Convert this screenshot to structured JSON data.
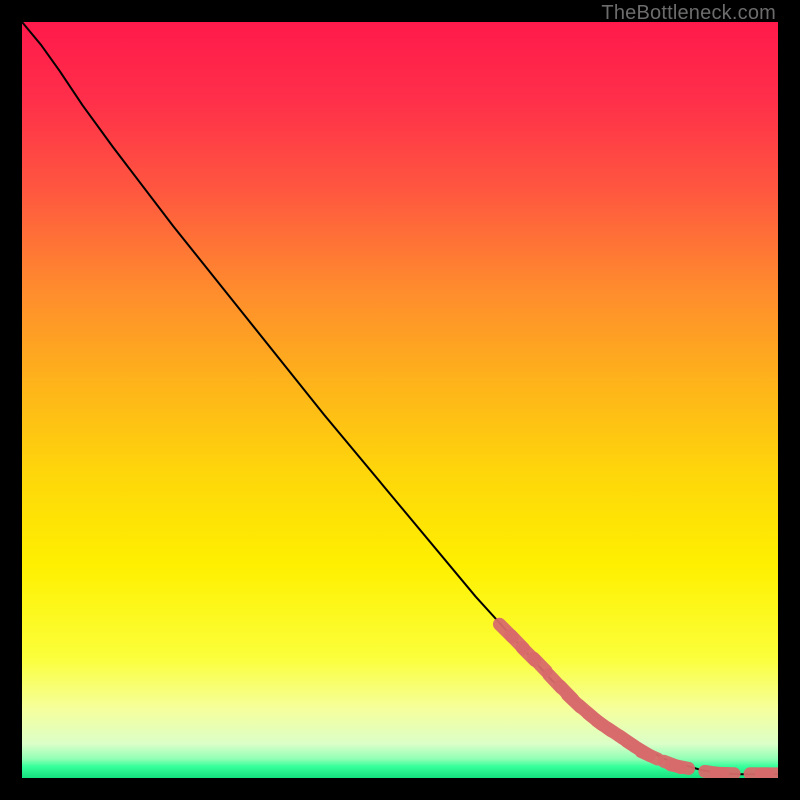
{
  "watermark": "TheBottleneck.com",
  "colors": {
    "background": "#000000",
    "line": "#000000",
    "dot": "#d86b6b",
    "gradient_stops": [
      {
        "offset": 0.0,
        "color": "#ff1a4b"
      },
      {
        "offset": 0.1,
        "color": "#ff2e4a"
      },
      {
        "offset": 0.22,
        "color": "#ff5640"
      },
      {
        "offset": 0.35,
        "color": "#ff8a2e"
      },
      {
        "offset": 0.48,
        "color": "#feb41a"
      },
      {
        "offset": 0.6,
        "color": "#fed70a"
      },
      {
        "offset": 0.72,
        "color": "#fef000"
      },
      {
        "offset": 0.84,
        "color": "#fbff3a"
      },
      {
        "offset": 0.91,
        "color": "#f5ff9e"
      },
      {
        "offset": 0.955,
        "color": "#dbffc8"
      },
      {
        "offset": 0.975,
        "color": "#8fffb5"
      },
      {
        "offset": 0.985,
        "color": "#34ff9a"
      },
      {
        "offset": 1.0,
        "color": "#15e07f"
      }
    ]
  },
  "chart_data": {
    "type": "line",
    "title": "",
    "xlabel": "",
    "ylabel": "",
    "xlim": [
      0,
      100
    ],
    "ylim": [
      0,
      100
    ],
    "legend": false,
    "grid": false,
    "series": [
      {
        "name": "bottleneck-curve",
        "x": [
          0.0,
          2.5,
          5.0,
          8.0,
          12.0,
          20.0,
          30.0,
          40.0,
          50.0,
          60.0,
          70.0,
          78.0,
          85.0,
          90.0,
          93.0,
          95.0,
          97.0,
          100.0
        ],
        "y": [
          100.0,
          97.0,
          93.5,
          89.0,
          83.5,
          73.0,
          60.5,
          48.0,
          36.0,
          24.0,
          13.0,
          6.5,
          2.5,
          1.0,
          0.6,
          0.5,
          0.5,
          0.5
        ]
      }
    ],
    "markers": [
      {
        "x": 64.0,
        "y": 19.5
      },
      {
        "x": 65.5,
        "y": 18.0
      },
      {
        "x": 67.0,
        "y": 16.4
      },
      {
        "x": 68.5,
        "y": 15.0
      },
      {
        "x": 70.5,
        "y": 12.8
      },
      {
        "x": 72.0,
        "y": 11.3
      },
      {
        "x": 73.0,
        "y": 10.2
      },
      {
        "x": 74.5,
        "y": 8.9
      },
      {
        "x": 75.8,
        "y": 7.8
      },
      {
        "x": 77.0,
        "y": 6.9
      },
      {
        "x": 78.5,
        "y": 5.9
      },
      {
        "x": 80.0,
        "y": 4.9
      },
      {
        "x": 81.0,
        "y": 4.2
      },
      {
        "x": 82.0,
        "y": 3.6
      },
      {
        "x": 83.0,
        "y": 3.0
      },
      {
        "x": 86.0,
        "y": 1.8
      },
      {
        "x": 87.0,
        "y": 1.5
      },
      {
        "x": 91.5,
        "y": 0.7
      },
      {
        "x": 93.0,
        "y": 0.6
      },
      {
        "x": 97.5,
        "y": 0.55
      },
      {
        "x": 99.0,
        "y": 0.55
      }
    ]
  }
}
